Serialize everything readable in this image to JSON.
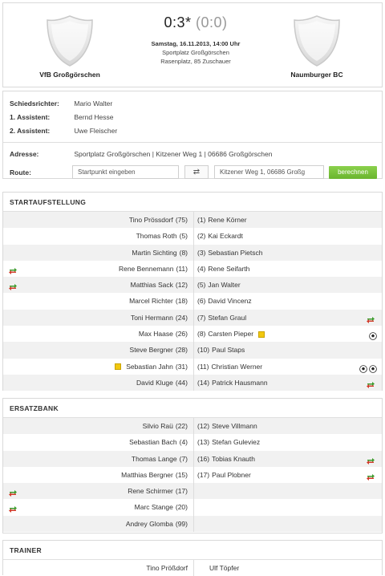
{
  "match": {
    "home_team": "VfB Großgörschen",
    "away_team": "Naumburger BC",
    "score": "0:3*",
    "halftime": "(0:0)",
    "date": "Samstag, 16.11.2013, 14:00 Uhr",
    "venue": "Sportplatz Großgörschen",
    "pitch": "Rasenplatz, 85 Zuschauer"
  },
  "officials": {
    "referee_label": "Schiedsrichter:",
    "referee": "Mario Walter",
    "assistant1_label": "1. Assistent:",
    "assistant1": "Bernd Hesse",
    "assistant2_label": "2. Assistent:",
    "assistant2": "Uwe Fleischer",
    "address_label": "Adresse:",
    "address": "Sportplatz Großgörschen  |  Kitzener Weg 1  |  06686 Großgörschen",
    "route_label": "Route:",
    "route_start_placeholder": "Startpunkt eingeben",
    "route_dest_value": "Kitzener Weg 1, 06686 Großg",
    "swap_symbol": "⇄",
    "calc_label": "berechnen"
  },
  "lineup": {
    "title": "STARTAUFSTELLUNG",
    "rows": [
      {
        "home": "Tino Prössdorf",
        "home_num": "(75)",
        "away_num": "(1)",
        "away": "Rene Körner"
      },
      {
        "home": "Thomas Roth",
        "home_num": "(5)",
        "away_num": "(2)",
        "away": "Kai Eckardt"
      },
      {
        "home": "Martin Sichting",
        "home_num": "(8)",
        "away_num": "(3)",
        "away": "Sebastian Pietsch"
      },
      {
        "home": "Rene Bennemann",
        "home_num": "(11)",
        "away_num": "(4)",
        "away": "Rene Seifarth"
      },
      {
        "home": "Matthias Sack",
        "home_num": "(12)",
        "away_num": "(5)",
        "away": "Jan Walter"
      },
      {
        "home": "Marcel Richter",
        "home_num": "(18)",
        "away_num": "(6)",
        "away": "David Vincenz"
      },
      {
        "home": "Toni Hermann",
        "home_num": "(24)",
        "away_num": "(7)",
        "away": "Stefan Graul"
      },
      {
        "home": "Max Haase",
        "home_num": "(26)",
        "away_num": "(8)",
        "away": "Carsten Pieper"
      },
      {
        "home": "Steve Bergner",
        "home_num": "(28)",
        "away_num": "(10)",
        "away": "Paul Staps"
      },
      {
        "home": "Sebastian Jahn",
        "home_num": "(31)",
        "away_num": "(11)",
        "away": "Christian Werner"
      },
      {
        "home": "David Kluge",
        "home_num": "(44)",
        "away_num": "(14)",
        "away": "Patrick Hausmann"
      }
    ]
  },
  "bench": {
    "title": "ERSATZBANK",
    "rows": [
      {
        "home": "Silvio Raü",
        "home_num": "(22)",
        "away_num": "(12)",
        "away": "Steve Villmann"
      },
      {
        "home": "Sebastian Bach",
        "home_num": "(4)",
        "away_num": "(13)",
        "away": "Stefan Guleviez"
      },
      {
        "home": "Thomas Lange",
        "home_num": "(7)",
        "away_num": "(16)",
        "away": "Tobias Knauth"
      },
      {
        "home": "Matthias Bergner",
        "home_num": "(15)",
        "away_num": "(17)",
        "away": "Paul Plobner"
      },
      {
        "home": "Rene Schirmer",
        "home_num": "(17)",
        "away_num": "",
        "away": ""
      },
      {
        "home": "Marc Stange",
        "home_num": "(20)",
        "away_num": "",
        "away": ""
      },
      {
        "home": "Andrey Glomba",
        "home_num": "(99)",
        "away_num": "",
        "away": ""
      }
    ]
  },
  "trainer": {
    "title": "TRAINER",
    "home": "Tino Prößdorf",
    "away": "Ulf Töpfer"
  },
  "icons": {
    "substitution": "substitution-icon",
    "yellow_card": "yellow-card-icon",
    "goal": "goal-ball-icon",
    "club_crest": "shield-crest-icon"
  },
  "colors": {
    "sub_in": "#3a9a2a",
    "sub_out": "#d23a2a",
    "yellow": "#f2c80f",
    "button_green": "#7cc23f"
  }
}
